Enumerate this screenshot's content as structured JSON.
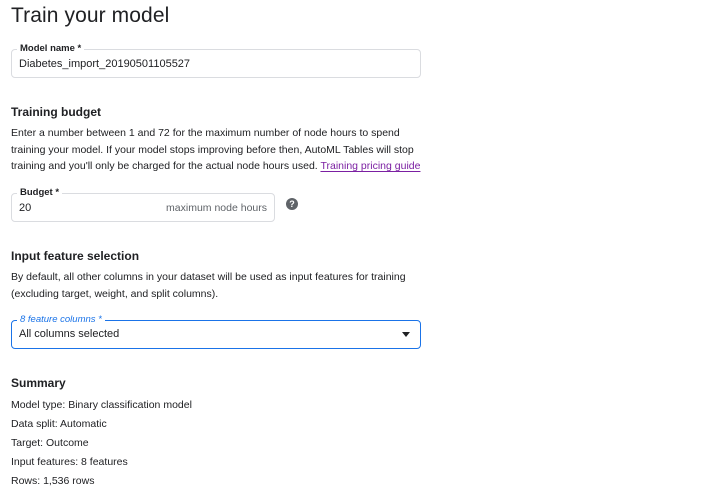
{
  "page": {
    "title": "Train your model"
  },
  "model_name": {
    "label": "Model name *",
    "value": "Diabetes_import_20190501105527"
  },
  "training_budget": {
    "heading": "Training budget",
    "description_line1": "Enter a number between 1 and 72 for the maximum number of node hours to spend",
    "description_line2": "training your model. If your model stops improving before then, AutoML Tables will stop",
    "description_line3": "training and you'll only be charged for the actual node hours used.",
    "link_text": "Training pricing guide",
    "budget_label": "Budget *",
    "budget_value": "20",
    "budget_suffix": "maximum node hours",
    "help_glyph": "?"
  },
  "input_feature_selection": {
    "heading": "Input feature selection",
    "description_line1": "By default, all other columns in your dataset will be used as input features for training",
    "description_line2": "(excluding target, weight, and split columns).",
    "select_label": "8 feature columns *",
    "select_value": "All columns selected"
  },
  "summary": {
    "heading": "Summary",
    "lines": [
      "Model type: Binary classification model",
      "Data split: Automatic",
      "Target: Outcome",
      "Input features: 8 features",
      "Rows: 1,536 rows"
    ]
  },
  "colors": {
    "accent": "#1a73e8",
    "link": "#7b1fa2",
    "text": "#202124",
    "muted": "#5f6368",
    "border": "#dadce0"
  },
  "icons": {
    "help": "help-circle-icon",
    "dropdown": "arrow-drop-down-icon"
  }
}
